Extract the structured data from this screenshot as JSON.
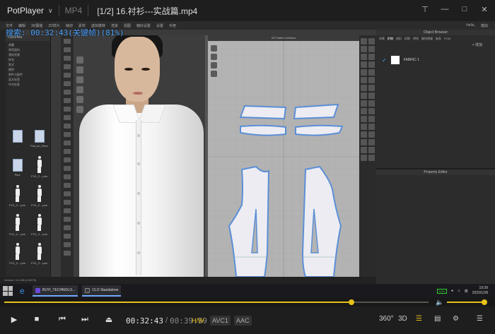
{
  "player": {
    "app_name": "PotPlayer",
    "format": "MP4",
    "title": "[1/2] 16.衬衫---实战篇.mp4",
    "search_overlay": "搜索: 00:32:43(关键帧)(81%)",
    "current_time": "00:32:43",
    "separator": "/",
    "total_time": "00:39:59",
    "progress": 0.818,
    "volume": 0.95,
    "badges": {
      "hw": "H/W",
      "video_codec": "AVC1",
      "audio_codec": "AAC"
    },
    "right_labels": {
      "view360": "360°",
      "view3d": "3D"
    }
  },
  "clo": {
    "menu_items": [
      "文件",
      "编辑",
      "3D服装",
      "2D样片",
      "缝纫",
      "素材",
      "虚拟模特",
      "渲染",
      "视图",
      "偏好设置",
      "设置",
      "手册"
    ],
    "user_label": "Hello,",
    "mode_label": "模拟",
    "library": {
      "header": "Favorites",
      "list": [
        "收藏",
        "常用面料",
        "我的资源",
        "样衣",
        "款式",
        "模特",
        "附件与配件",
        "英文标签",
        "中文标签"
      ],
      "thumbs": [
        "..",
        "Flat_on_Floor",
        "Plus",
        "FV1_2....pos",
        "FV1_2....pos",
        "FV1_2....pos",
        "FV1_2....pos",
        "FV1_2....pos",
        "FV1_2....pos",
        "FV1_2....pos",
        "FV1_2....pos",
        "FV1_2....pos",
        "FV1_2....pos",
        "FV1_2....pos"
      ]
    },
    "window_2d_title": "2D Pattern Window",
    "object_browser": {
      "title": "Object Browser",
      "tabs": [
        "场景",
        "织物",
        "纽扣",
        "扣眼",
        "明线",
        "缝纫褶皱",
        "嵌条",
        "POM"
      ],
      "fabric_name": "FABRIC 1",
      "add_label": "+ 增加"
    },
    "property_editor_title": "Property Editor",
    "status_text": "Version: 5.0.188 (r44075)",
    "float_button": "Clo3D"
  },
  "taskbar": {
    "apps": [
      "BUYI_TECHNOLO...",
      "CLO Standalone"
    ],
    "battery": "67%",
    "ime": "英",
    "time": "19:39",
    "date": "2020/12/8"
  },
  "colors": {
    "accent_yellow": "#e8c21a",
    "overlay_blue": "#4da3ff",
    "pattern_blue": "#5b8fd6"
  }
}
